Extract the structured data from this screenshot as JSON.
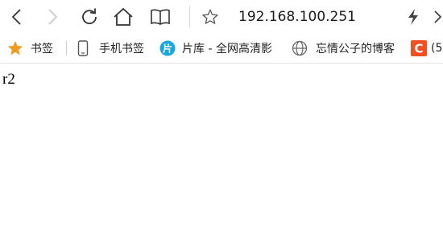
{
  "toolbar": {
    "back_icon": "chevron-left-icon",
    "forward_icon": "chevron-right-icon",
    "refresh_icon": "refresh-icon",
    "home_icon": "home-icon",
    "reading_icon": "book-icon",
    "favorite_icon": "star-outline-icon",
    "address": "192.168.100.251",
    "lightning_icon": "lightning-icon",
    "right_icon": "chevron-right-icon"
  },
  "bookmarks": {
    "items": [
      {
        "label": "书签",
        "icon": "star-icon",
        "color": "#f29a1f"
      },
      {
        "label": "手机书签",
        "icon": "phone-icon"
      },
      {
        "label": "片库 - 全网高清影",
        "icon": "pianku-icon",
        "color": "#1aa6e0",
        "icon_text": "片"
      },
      {
        "label": "忘情公子的博客",
        "icon": "globe-icon"
      },
      {
        "label": "(5",
        "icon": "c-logo-icon",
        "color": "#f04e23",
        "icon_text": "C"
      }
    ]
  },
  "page": {
    "body_text": "r2"
  }
}
